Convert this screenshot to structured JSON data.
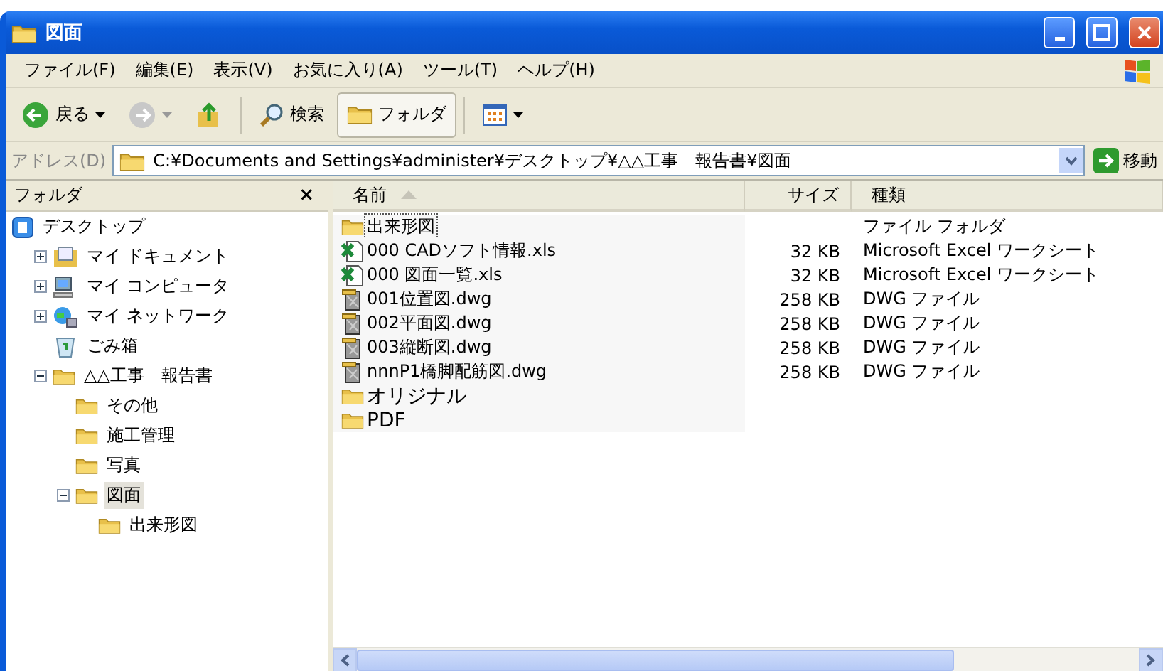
{
  "window": {
    "title": "図面"
  },
  "menu": [
    "ファイル(F)",
    "編集(E)",
    "表示(V)",
    "お気に入り(A)",
    "ツール(T)",
    "ヘルプ(H)"
  ],
  "toolbar": {
    "back": "戻る",
    "search": "検索",
    "folders": {
      "label": "フォルダ",
      "selected": true
    }
  },
  "address": {
    "label": "アドレス(D)",
    "value": "C:¥Documents and Settings¥administer¥デスクトップ¥△△工事　報告書¥図面",
    "go": "移動"
  },
  "folders_pane": {
    "title": "フォルダ",
    "close": "×",
    "tree": [
      {
        "label": "デスクトップ",
        "kind": "desktop",
        "selected": false,
        "children": [
          {
            "label": "マイ ドキュメント",
            "kind": "documents",
            "expandable": true,
            "expanded": false,
            "selected": false
          },
          {
            "label": "マイ コンピュータ",
            "kind": "computer",
            "expandable": true,
            "expanded": false,
            "selected": false
          },
          {
            "label": "マイ ネットワーク",
            "kind": "network",
            "expandable": true,
            "expanded": false,
            "selected": false
          },
          {
            "label": "ごみ箱",
            "kind": "recycle",
            "expandable": false,
            "selected": false
          },
          {
            "label": "△△工事　報告書",
            "kind": "folder",
            "expandable": true,
            "expanded": true,
            "selected": false,
            "children": [
              {
                "label": "その他",
                "kind": "folder",
                "expandable": false,
                "selected": false
              },
              {
                "label": "施工管理",
                "kind": "folder",
                "expandable": false,
                "selected": false
              },
              {
                "label": "写真",
                "kind": "folder",
                "expandable": false,
                "selected": false
              },
              {
                "label": "図面",
                "kind": "folder",
                "expandable": true,
                "expanded": true,
                "selected": true,
                "children": [
                  {
                    "label": "出来形図",
                    "kind": "folder",
                    "expandable": false,
                    "selected": false
                  }
                ]
              }
            ]
          }
        ]
      }
    ]
  },
  "files": {
    "columns": [
      {
        "label": "名前",
        "sorted": true
      },
      {
        "label": "サイズ",
        "sorted": false
      },
      {
        "label": "種類",
        "sorted": false
      }
    ],
    "rows": [
      {
        "name": "出来形図",
        "type": "ファイル フォルダ",
        "kind": "folder",
        "selected": true
      },
      {
        "name": "000 CADソフト情報.xls",
        "size": "32 KB",
        "type": "Microsoft Excel ワークシート",
        "kind": "excel",
        "selected": false
      },
      {
        "name": "000 図面一覧.xls",
        "size": "32 KB",
        "type": "Microsoft Excel ワークシート",
        "kind": "excel",
        "selected": false
      },
      {
        "name": "001位置図.dwg",
        "size": "258 KB",
        "type": "DWG ファイル",
        "kind": "dwg",
        "selected": false
      },
      {
        "name": "002平面図.dwg",
        "size": "258 KB",
        "type": "DWG ファイル",
        "kind": "dwg",
        "selected": false
      },
      {
        "name": "003縦断図.dwg",
        "size": "258 KB",
        "type": "DWG ファイル",
        "kind": "dwg",
        "selected": false
      },
      {
        "name": "nnnP1橋脚配筋図.dwg",
        "size": "258 KB",
        "type": "DWG ファイル",
        "kind": "dwg",
        "selected": false
      },
      {
        "name": "オリジナル",
        "kind": "folder",
        "selected": false
      },
      {
        "name": "PDF",
        "kind": "folder",
        "selected": false
      }
    ]
  }
}
